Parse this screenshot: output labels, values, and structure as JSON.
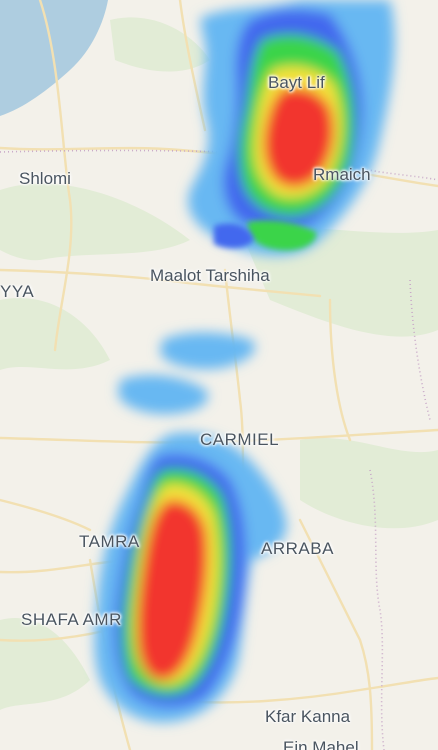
{
  "map": {
    "layer": "weather-radar",
    "colors": {
      "land": "#f3f1ea",
      "sea": "#aecde0",
      "green_area": "#e2ecd6",
      "road": "#f2e0b2",
      "border": "#c9a9c8",
      "radar_light": "#68b8f2",
      "radar_blue": "#4368ee",
      "radar_green": "#3ad44a",
      "radar_yellow": "#f4e23a",
      "radar_red": "#f2362f"
    }
  },
  "places": {
    "bayt_lif": "Bayt Lif",
    "rmaich": "Rmaich",
    "shlomi": "Shlomi",
    "yya": "YYA",
    "maalot_tarshiha": "Maalot Tarshiha",
    "carmiel": "CARMIEL",
    "tamra": "TAMRA",
    "arraba": "ARRABA",
    "shafa_amr": "SHAFA AMR",
    "kfar_kanna": "Kfar Kanna",
    "ein_mahel": "Ein Mahel"
  }
}
